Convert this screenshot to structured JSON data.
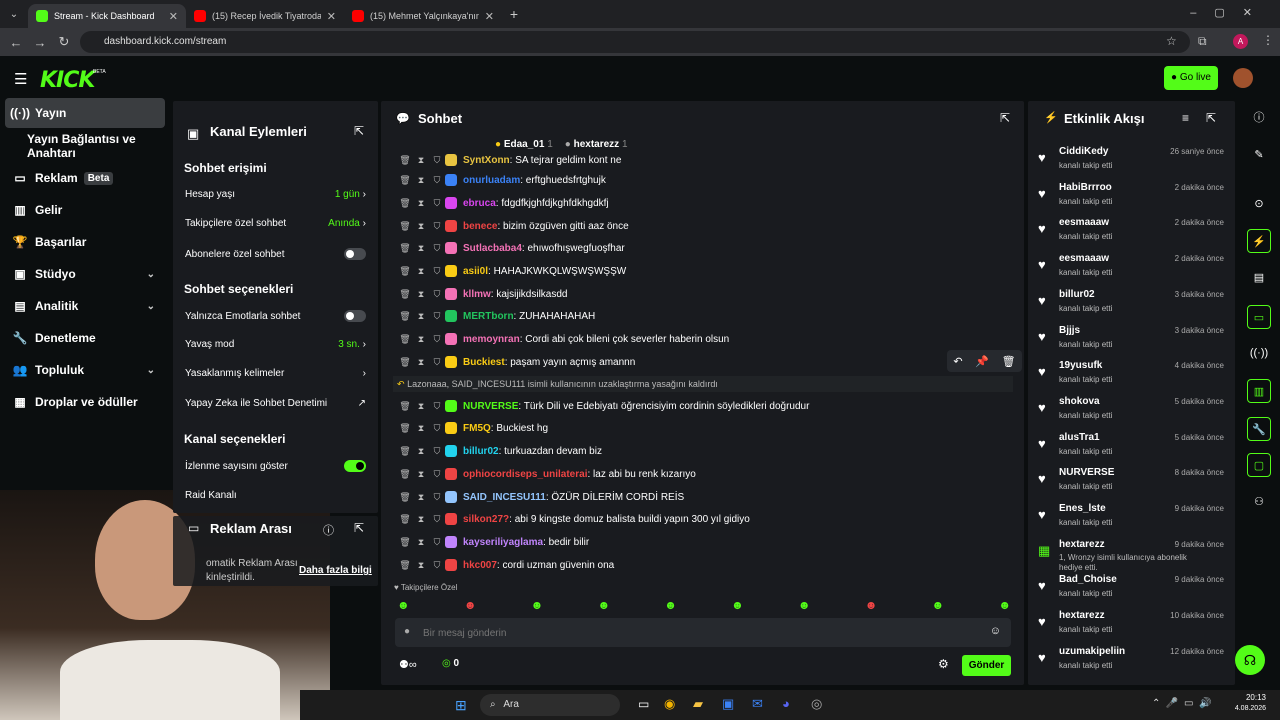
{
  "browser": {
    "tabs": [
      {
        "label": "Stream - Kick Dashboard"
      },
      {
        "label": "(15) Recep İvedik Tiyatroda. #re"
      },
      {
        "label": "(15) Mehmet Yalçınkaya'nın Mu"
      }
    ],
    "url": "dashboard.kick.com/stream"
  },
  "header": {
    "logo": "KICK",
    "beta": "BETA",
    "go_live": "Go live"
  },
  "nav": {
    "items": [
      {
        "label": "Yayın"
      },
      {
        "label": "Yayın Bağlantısı ve Anahtarı"
      },
      {
        "label": "Reklam",
        "badge": "Beta"
      },
      {
        "label": "Gelir"
      },
      {
        "label": "Başarılar"
      },
      {
        "label": "Stüdyo"
      },
      {
        "label": "Analitik"
      },
      {
        "label": "Denetleme"
      },
      {
        "label": "Topluluk"
      },
      {
        "label": "Droplar ve ödüller"
      }
    ]
  },
  "channel_actions": {
    "title": "Kanal Eylemleri",
    "chat_access": "Sohbet erişimi",
    "account_age": "Hesap yaşı",
    "account_age_val": "1 gün",
    "followers_only": "Takipçilere özel sohbet",
    "followers_only_val": "Anında",
    "subs_only": "Abonelere özel sohbet",
    "chat_options": "Sohbet seçenekleri",
    "emote_only": "Yalnızca Emotlarla sohbet",
    "slow_mode": "Yavaş mod",
    "slow_mode_val": "3 sn.",
    "banned_words": "Yasaklanmış kelimeler",
    "ai_moderation": "Yapay Zeka ile Sohbet Denetimi",
    "channel_options": "Kanal seçenekleri",
    "show_viewers": "İzlenme sayısını göster",
    "raid": "Raid Kanalı"
  },
  "ad_break": {
    "title": "Reklam Arası",
    "text1": "omatik Reklam Arası",
    "text2": "kinleştirildi.",
    "more": "Daha fazla bilgi"
  },
  "chat": {
    "title": "Sohbet",
    "top1": "Edaa_01",
    "top1_n": "1",
    "top2": "hextarezz",
    "top2_n": "1",
    "messages": [
      {
        "user": "SyntXonn",
        "text": ": SA tejrar geldim kont ne",
        "color": "#e8c441"
      },
      {
        "user": "onurluadam",
        "text": ": erftghuedsfrtghujk",
        "color": "#3b82f6"
      },
      {
        "user": "ebruca",
        "text": ": fdgdfkjghfdjkghfdkhgdkfj",
        "color": "#d946ef"
      },
      {
        "user": "benece",
        "text": ": bizim özgüven gitti aaz önce",
        "color": "#ef4444"
      },
      {
        "user": "Sutlacbaba4",
        "text": ": ehıwofhışwegfuoşfhar",
        "color": "#f472b6"
      },
      {
        "user": "asii0l",
        "text": ": HAHAJKWKQLWŞWŞWŞŞW",
        "color": "#facc15"
      },
      {
        "user": "kllmw",
        "text": ": kajsijikdsilkasdd",
        "color": "#f472b6"
      },
      {
        "user": "MERTborn",
        "text": ": ZUHAHAHAHAH",
        "color": "#22c55e"
      },
      {
        "user": "memoynran",
        "text": ": Cordi abi çok bileni çok severler haberin olsun",
        "color": "#f472b6"
      },
      {
        "user": "Buckiest",
        "text": ": paşam yayın açmış amannn",
        "color": "#facc15"
      },
      {
        "user": "NURVERSE",
        "text": ": Türk Dili ve Edebiyatı öğrencisiyim cordinin söyledikleri doğrudur",
        "color": "#53fc18"
      },
      {
        "user": "FM5Q",
        "text": ": Buckiest hg",
        "color": "#facc15"
      },
      {
        "user": "billur02",
        "text": ": turkuazdan devam biz",
        "color": "#22d3ee"
      },
      {
        "user": "ophiocordiseps_unilaterai",
        "text": ": laz abi bu renk kızarıyo",
        "color": "#ef4444"
      },
      {
        "user": "SAID_INCESU111",
        "text": ": ÖZÜR DİLERİM CORDİ REİS",
        "color": "#93c5fd"
      },
      {
        "user": "silkon27?",
        "text": ": abi 9 kingste domuz balista buildi yapın 300 yıl gidiyo",
        "color": "#ef4444"
      },
      {
        "user": "kayseriliyaglama",
        "text": ": bedir bilir",
        "color": "#c084fc"
      },
      {
        "user": "hkc007",
        "text": ": cordi uzman güvenin ona",
        "color": "#ef4444"
      }
    ],
    "system": "Lazonaaa, SAID_INCESU111 isimli kullanıcının uzaklaştırma yasağını kaldırdı",
    "followers_label": "Takipçilere Özel",
    "placeholder": "Bir mesaj gönderin",
    "points": "0",
    "send": "Gönder"
  },
  "activity": {
    "title": "Etkinlik Akışı",
    "items": [
      {
        "name": "CiddiKedy",
        "sub": "kanalı takip etti",
        "time": "26 saniye önce"
      },
      {
        "name": "HabiBrrroo",
        "sub": "kanalı takip etti",
        "time": "2 dakika önce"
      },
      {
        "name": "eesmaaaw",
        "sub": "kanalı takip etti",
        "time": "2 dakika önce"
      },
      {
        "name": "eesmaaaw",
        "sub": "kanalı takip etti",
        "time": "2 dakika önce"
      },
      {
        "name": "billur02",
        "sub": "kanalı takip etti",
        "time": "3 dakika önce"
      },
      {
        "name": "Bjjjs",
        "sub": "kanalı takip etti",
        "time": "3 dakika önce"
      },
      {
        "name": "19yusufk",
        "sub": "kanalı takip etti",
        "time": "4 dakika önce"
      },
      {
        "name": "shokova",
        "sub": "kanalı takip etti",
        "time": "5 dakika önce"
      },
      {
        "name": "alusTra1",
        "sub": "kanalı takip etti",
        "time": "5 dakika önce"
      },
      {
        "name": "NURVERSE",
        "sub": "kanalı takip etti",
        "time": "8 dakika önce"
      },
      {
        "name": "Enes_lste",
        "sub": "kanalı takip etti",
        "time": "9 dakika önce"
      },
      {
        "name": "hextarezz",
        "sub": "1, Wronzy isimli kullanıcıya abonelik hediye etti.",
        "time": "9 dakika önce"
      },
      {
        "name": "Bad_Choise",
        "sub": "kanalı takip etti",
        "time": "9 dakika önce"
      },
      {
        "name": "hextarezz",
        "sub": "kanalı takip etti",
        "time": "10 dakika önce"
      },
      {
        "name": "uzumakipeliin",
        "sub": "kanalı takip etti",
        "time": "12 dakika önce"
      }
    ]
  },
  "taskbar": {
    "search": "Ara",
    "time": "20:13",
    "date": "4.08.2026"
  }
}
